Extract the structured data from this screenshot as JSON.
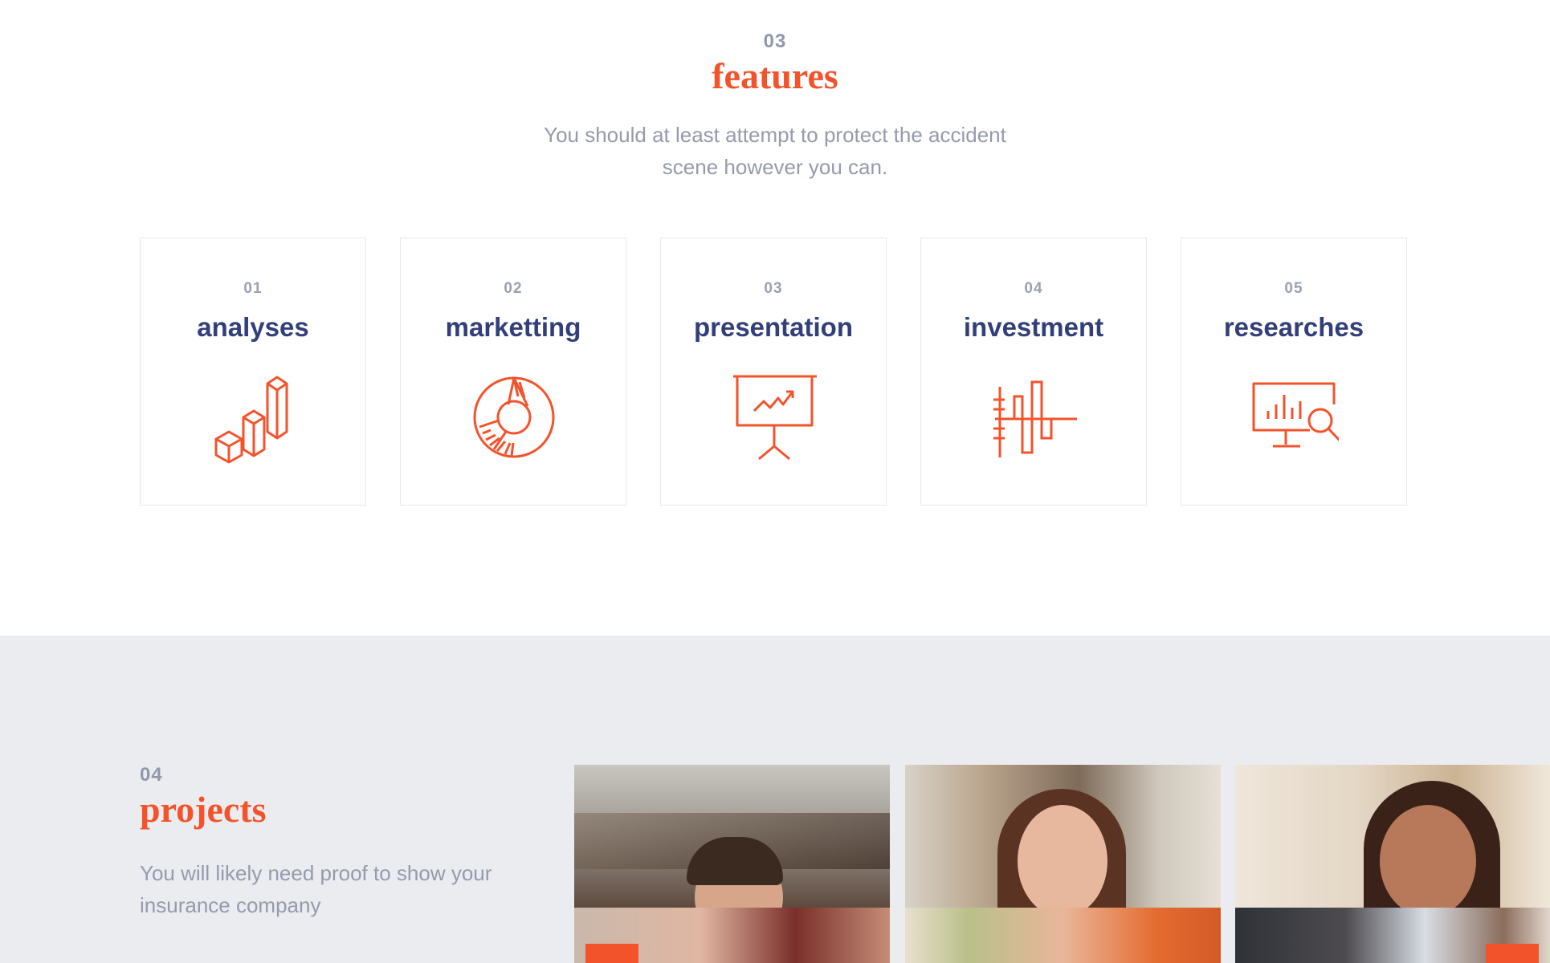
{
  "features": {
    "number": "03",
    "title": "features",
    "description": "You should at least attempt to protect the accident scene however you can.",
    "cards": [
      {
        "number": "01",
        "title": "analyses",
        "icon": "bar-cubes-icon"
      },
      {
        "number": "02",
        "title": "marketting",
        "icon": "donut-chart-icon"
      },
      {
        "number": "03",
        "title": "presentation",
        "icon": "presentation-board-icon"
      },
      {
        "number": "04",
        "title": "investment",
        "icon": "bar-levels-icon"
      },
      {
        "number": "05",
        "title": "researches",
        "icon": "monitor-search-icon"
      }
    ]
  },
  "projects": {
    "number": "04",
    "title": "projects",
    "description": "You will likely need proof to show your insurance company"
  },
  "colors": {
    "accent": "#f3532b",
    "heading": "#323f7a",
    "muted": "#959aad",
    "section_bg": "#ebecf0"
  }
}
